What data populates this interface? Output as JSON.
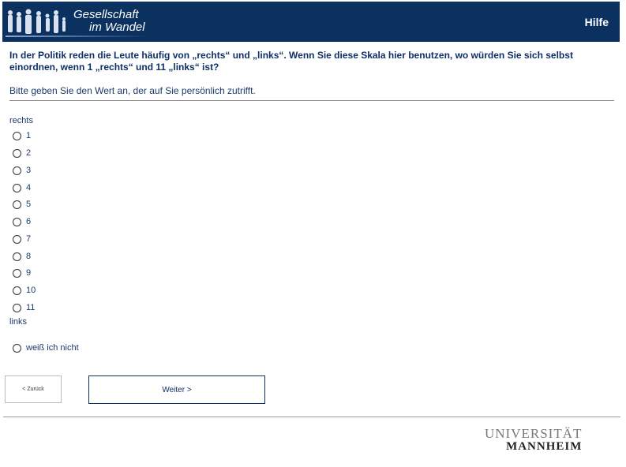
{
  "header": {
    "logo_line1": "Gesellschaft",
    "logo_line2": "im Wandel",
    "help_label": "Hilfe",
    "bg_color": "#0b3160"
  },
  "question": {
    "text": "In der Politik reden die Leute häufig von „rechts“ und „links“. Wenn Sie diese Skala hier benutzen, wo würden Sie sich selbst einordnen, wenn 1 „rechts“ und 11 „links“ ist?",
    "instruction": "Bitte geben Sie den Wert an, der auf Sie persönlich zutrifft."
  },
  "scale": {
    "top_label": "rechts",
    "bottom_label": "links",
    "options": [
      "1",
      "2",
      "3",
      "4",
      "5",
      "6",
      "7",
      "8",
      "9",
      "10",
      "11"
    ],
    "dont_know": "weiß ich nicht"
  },
  "nav": {
    "back_label": "< Zurück",
    "next_label": "Weiter >"
  },
  "footer": {
    "uni_line1": "UNIVERSITÄT",
    "uni_line2": "MANNHEIM"
  }
}
